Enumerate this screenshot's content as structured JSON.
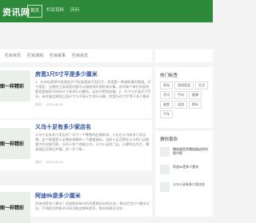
{
  "header": {
    "logo": "资讯网",
    "nav": [
      "首页",
      "栏目百科",
      "问问"
    ]
  },
  "subnav": [
    "栏目资讯",
    "栏目游戏",
    "栏目故事",
    "栏目杂志"
  ],
  "articles": [
    {
      "thumb_text": "图一样精彩",
      "title": "房宽1尺5寸平是多少厘米",
      "desc": "1、在市场营销中房宽的尺寸标准是指平面尺寸，房宽是一种按照量的数值。尺寸规定，当建房立面高度时都可以按照房的面积来计算，房间每个单位的面积都是要按照不同的尺寸来进行计算的，这样才更加准确。2、尺寸与平面尺寸不同，有时候会按照立面尺寸与平面尺寸进行计算。房宽1尺5寸平等于多少厘米呢？以...",
      "meta": [
        "知识",
        "2023-06-19"
      ]
    },
    {
      "thumb_text": "图一样精彩",
      "title": "义乌十足有多少家店名",
      "desc": "义乌十足有多少家店名？对于一个零售的店铺来说，十足在义乌有多少家店铺，这个数量是十足整体规模的一个重要指标。当前十足品牌在义乌的门店数量大约在数百家，分布于各个商圈之中。义乌十足的门店，以便利店为主，覆盖城区及周边乡镇。进一步了解...",
      "meta": [
        "知识",
        "2023-06-19"
      ]
    },
    {
      "thumb_text": "图一样精彩",
      "title": "阿迪9k是多少厘米",
      "desc": "阿迪9k是多少厘米？阿迪鞋码9k对应的是欧码43码左右，脚长约为27.5厘米左右。不同款式的鞋子尺码可能会略有差异，购买前建议试穿...",
      "meta": [
        "知识",
        "2023-06-19"
      ]
    }
  ],
  "sidebar": {
    "hot_tags_title": "热门标签",
    "tags": [
      "家电",
      "游戏家居",
      "生活",
      "资讯",
      "手机",
      "健康",
      "美食",
      "旅游",
      "数码",
      "汽车"
    ],
    "rec_title": "猜你喜欢",
    "rec": [
      "播放器是多播放器这样的图书版",
      "阿迪9k是多少厘米",
      "义乌十足有多少家店名"
    ]
  }
}
